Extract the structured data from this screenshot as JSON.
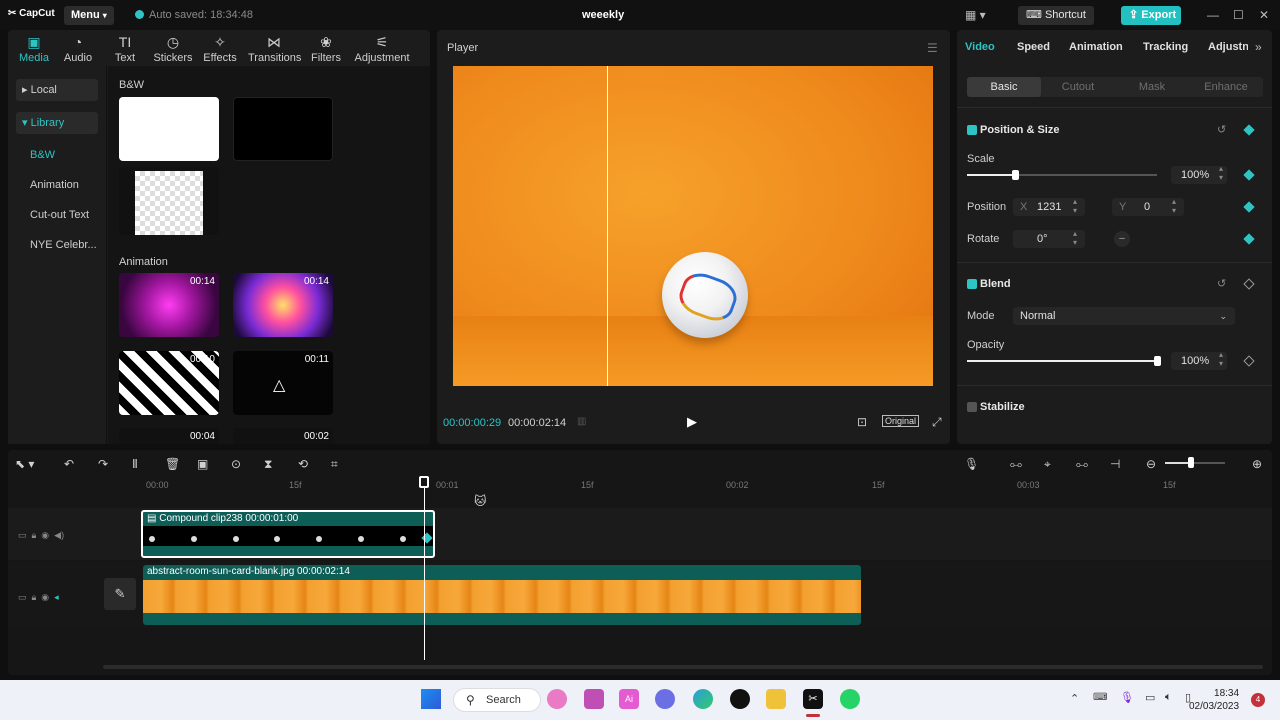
{
  "app": {
    "brand": "CapCut",
    "menu_label": "Menu",
    "autosave": "Auto saved: 18:34:48",
    "project_title": "weeekly",
    "shortcut_label": "Shortcut",
    "export_label": "Export"
  },
  "media_tabs": [
    "Media",
    "Audio",
    "Text",
    "Stickers",
    "Effects",
    "Transitions",
    "Filters",
    "Adjustment"
  ],
  "media_sidebar": {
    "local": "Local",
    "library": "Library",
    "subs": [
      "B&W",
      "Animation",
      "Cut-out Text",
      "NYE Celebr..."
    ]
  },
  "media_sections": {
    "bw": "B&W",
    "animation": "Animation"
  },
  "animation_durations": [
    "00:14",
    "00:14",
    "00:10",
    "00:11",
    "00:04",
    "00:02"
  ],
  "player": {
    "title": "Player",
    "current_time": "00:00:00:29",
    "total_time": "00:00:02:14",
    "original_label": "Original"
  },
  "props": {
    "tabs": [
      "Video",
      "Speed",
      "Animation",
      "Tracking",
      "Adjustn"
    ],
    "subtabs": [
      "Basic",
      "Cutout",
      "Mask",
      "Enhance"
    ],
    "position_size": "Position & Size",
    "scale_label": "Scale",
    "scale_value": "100%",
    "position_label": "Position",
    "x_label": "X",
    "x_value": "1231",
    "y_label": "Y",
    "y_value": "0",
    "rotate_label": "Rotate",
    "rotate_value": "0°",
    "blend_title": "Blend",
    "mode_label": "Mode",
    "mode_value": "Normal",
    "opacity_label": "Opacity",
    "opacity_value": "100%",
    "stabilize_label": "Stabilize",
    "scale_level": 0.25,
    "opacity_level": 1.0
  },
  "timeline": {
    "ruler": [
      "00:00",
      "15f",
      "00:01",
      "15f",
      "00:02",
      "15f",
      "00:03",
      "15f"
    ],
    "compound_clip": "Compound clip238  00:00:01:00",
    "image_clip": "abstract-room-sun-card-blank.jpg  00:00:02:14"
  },
  "taskbar": {
    "search": "Search",
    "time": "18:34",
    "date": "02/03/2023",
    "notifications": "4"
  },
  "colors": {
    "accent": "#2ec4c4",
    "clip": "#0e5e58",
    "video_bg": "#ef8a1d"
  }
}
